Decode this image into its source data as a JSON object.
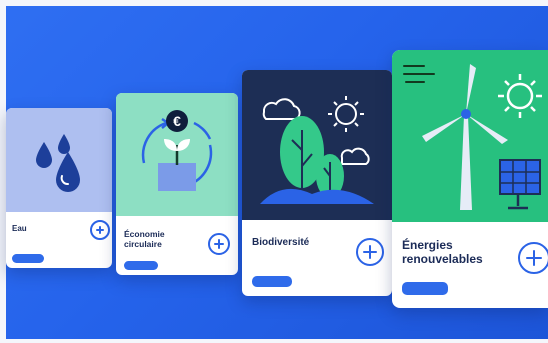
{
  "background": {
    "color": "#2563eb"
  },
  "cards": [
    {
      "id": "eau",
      "title": "Eau",
      "art_color": "#aebff0",
      "icon": "water-drops-icon"
    },
    {
      "id": "economie",
      "title": "Économie circulaire",
      "art_color": "#8ddfc3",
      "icon": "circular-economy-icon",
      "coin_symbol": "€"
    },
    {
      "id": "biodiversite",
      "title": "Biodiversité",
      "art_color": "#1d2e55",
      "icon": "trees-icon"
    },
    {
      "id": "energies",
      "title": "Énergies renouvelables",
      "art_color": "#27c07f",
      "icon": "wind-turbine-icon"
    }
  ],
  "accent_color": "#2b63e6"
}
